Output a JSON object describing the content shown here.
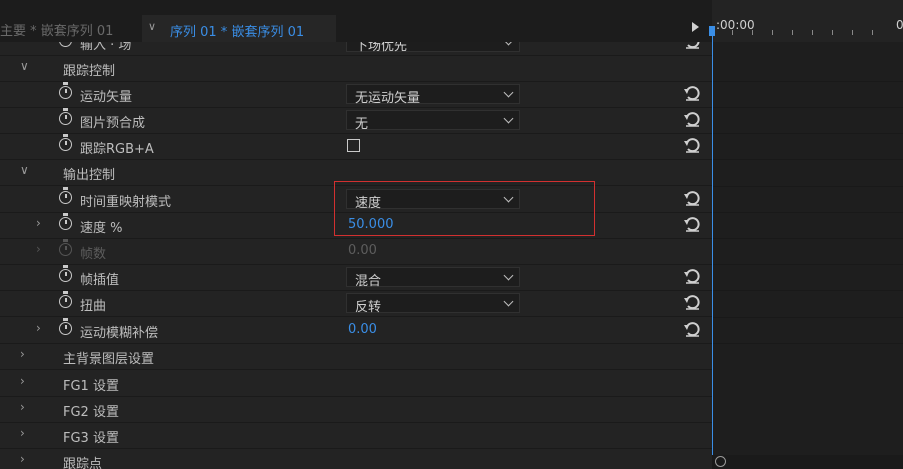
{
  "tabs": {
    "inactive_label": "主要 * 嵌套序列 01",
    "active_label": "序列 01 * 嵌套序列 01"
  },
  "timeline": {
    "start_time": ":00:00",
    "end_time_partial": "0"
  },
  "rows": {
    "r0": {
      "label": "输入 · 场",
      "value": "下场优先"
    },
    "r1": {
      "label": "跟踪控制"
    },
    "r2": {
      "label": "运动矢量",
      "value": "无运动矢量"
    },
    "r3": {
      "label": "图片预合成",
      "value": "无"
    },
    "r4": {
      "label": "跟踪RGB+A"
    },
    "r5": {
      "label": "输出控制"
    },
    "r6": {
      "label": "时间重映射模式",
      "value": "速度"
    },
    "r7": {
      "label": "速度 %",
      "value": "50.000"
    },
    "r8": {
      "label": "帧数",
      "value": "0.00"
    },
    "r9": {
      "label": "帧插值",
      "value": "混合"
    },
    "r10": {
      "label": "扭曲",
      "value": "反转"
    },
    "r11": {
      "label": "运动模糊补偿",
      "value": "0.00"
    },
    "r12": {
      "label": "主背景图层设置"
    },
    "r13": {
      "label": "FG1 设置"
    },
    "r14": {
      "label": "FG2 设置"
    },
    "r15": {
      "label": "FG3 设置"
    },
    "r16": {
      "label": "跟踪点"
    }
  },
  "icons": {
    "stopwatch": "stopwatch-icon",
    "reset": "reset-icon",
    "expand": "chevron-right-icon",
    "collapse": "chevron-down-icon",
    "play": "play-icon"
  },
  "colors": {
    "accent": "#3a8ee6",
    "highlight": "#d23030",
    "panel_bg": "#232323"
  }
}
